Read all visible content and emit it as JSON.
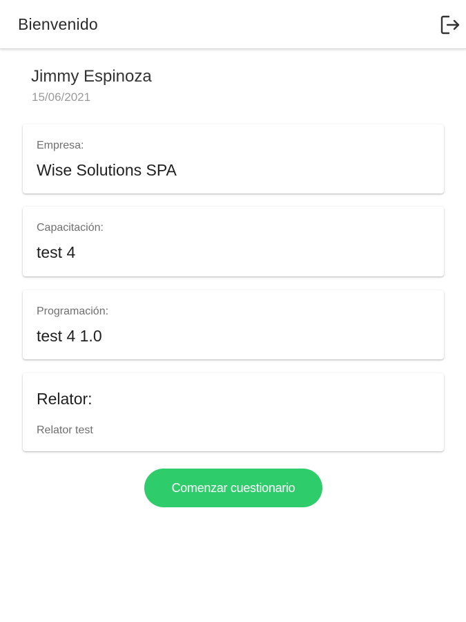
{
  "header": {
    "title": "Bienvenido",
    "logout_icon": "logout-icon"
  },
  "user": {
    "name": "Jimmy Espinoza",
    "date": "15/06/2021"
  },
  "cards": {
    "empresa": {
      "label": "Empresa:",
      "value": "Wise Solutions SPA"
    },
    "capacitacion": {
      "label": "Capacitación:",
      "value": "test 4"
    },
    "programacion": {
      "label": "Programación:",
      "value": "test 4 1.0"
    },
    "relator": {
      "heading": "Relator:",
      "value": "Relator test"
    }
  },
  "actions": {
    "start_label": "Comenzar cuestionario"
  },
  "colors": {
    "accent": "#2ecc6a",
    "text": "#222222",
    "muted": "#9a9a9a"
  }
}
